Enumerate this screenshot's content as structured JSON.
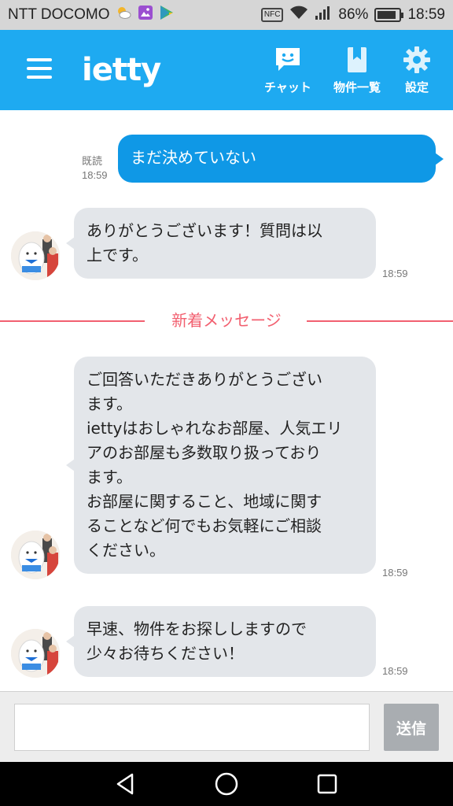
{
  "status_bar": {
    "carrier": "NTT DOCOMO",
    "nfc": "NFC",
    "battery_percent": "86%",
    "battery_level": 0.86,
    "time": "18:59",
    "icons": [
      "weather-icon",
      "image-icon",
      "play-store-icon",
      "nfc-icon",
      "wifi-icon",
      "signal-icon",
      "battery-icon"
    ]
  },
  "header": {
    "logo": "ietty",
    "nav": [
      {
        "label": "チャット",
        "icon": "chat-icon"
      },
      {
        "label": "物件一覧",
        "icon": "bookmark-icon"
      },
      {
        "label": "設定",
        "icon": "gear-icon"
      }
    ],
    "accent_color": "#1eaaf1"
  },
  "messages": [
    {
      "direction": "out",
      "text": "まだ決めていない",
      "read_label": "既読",
      "time": "18:59"
    },
    {
      "direction": "in",
      "text": "ありがとうございます！質問は以\n上です。",
      "time": "18:59"
    },
    {
      "direction": "in",
      "text": "ご回答いただきありがとうござい\nます。\niettyはおしゃれなお部屋、人気エリ\nアのお部屋も多数取り扱っており\nます。\nお部屋に関すること、地域に関す\nることなど何でもお気軽にご相談\nください。",
      "time": "18:59"
    },
    {
      "direction": "in",
      "text": "早速、物件をお探ししますので\n少々お待ちください！",
      "time": "18:59"
    }
  ],
  "divider": {
    "label": "新着メッセージ",
    "color": "#f26070"
  },
  "input": {
    "value": "",
    "placeholder": "",
    "send_label": "送信"
  },
  "colors": {
    "outgoing_bubble": "#0f98e6",
    "incoming_bubble": "#e3e6ea",
    "send_button": "#a9adb1"
  }
}
